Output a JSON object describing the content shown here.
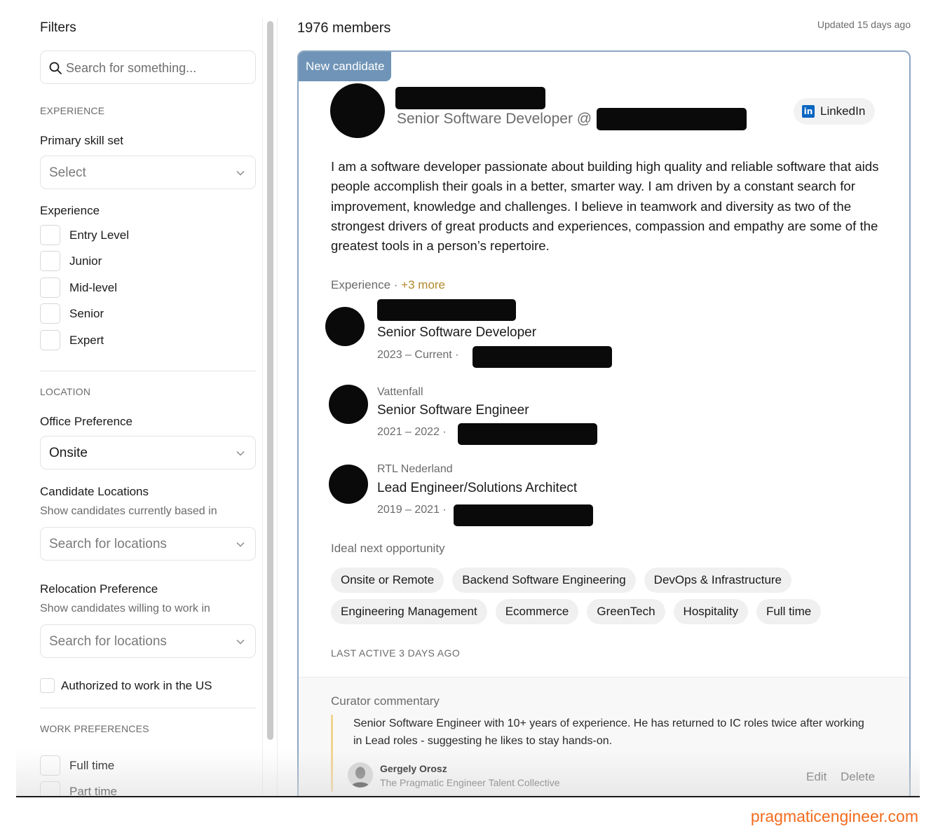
{
  "sidebar": {
    "title": "Filters",
    "search_placeholder": "Search for something...",
    "experience_section": "EXPERIENCE",
    "primary_skill_label": "Primary skill set",
    "primary_skill_value": "Select",
    "experience_label": "Experience",
    "experience_levels": [
      "Entry Level",
      "Junior",
      "Mid-level",
      "Senior",
      "Expert"
    ],
    "location_section": "LOCATION",
    "office_pref_label": "Office Preference",
    "office_pref_value": "Onsite",
    "candidate_locations_label": "Candidate Locations",
    "candidate_locations_help": "Show candidates currently based in",
    "candidate_locations_placeholder": "Search for locations",
    "relocation_label": "Relocation Preference",
    "relocation_help": "Show candidates willing to work in",
    "relocation_placeholder": "Search for locations",
    "authorized_label": "Authorized to work in the US",
    "work_pref_section": "WORK PREFERENCES",
    "work_prefs": [
      "Full time",
      "Part time"
    ]
  },
  "header": {
    "members_count": "1976 members",
    "updated": "Updated 15 days ago"
  },
  "card": {
    "badge": "New candidate",
    "headline": "Senior Software Developer @",
    "linkedin_label": "LinkedIn",
    "bio": "I am a software developer passionate about building high quality and reliable software that aids people accomplish their goals in a better, smarter way. I am driven by a constant search for improvement, knowledge and challenges. I believe in teamwork and diversity as two of the strongest drivers of great products and experiences, compassion and empathy are some of the greatest tools in a person’s repertoire.",
    "experience_label": "Experience ·",
    "experience_more": "+3 more",
    "jobs": [
      {
        "company": "",
        "title": "Senior Software Developer",
        "dates": "2023 – Current ·"
      },
      {
        "company": "Vattenfall",
        "title": "Senior Software Engineer",
        "dates": "2021 – 2022 ·"
      },
      {
        "company": "RTL Nederland",
        "title": "Lead Engineer/Solutions Architect",
        "dates": "2019 – 2021 ·"
      }
    ],
    "ideal_label": "Ideal next opportunity",
    "chips": [
      "Onsite or Remote",
      "Backend Software Engineering",
      "DevOps & Infrastructure",
      "Engineering Management",
      "Ecommerce",
      "GreenTech",
      "Hospitality",
      "Full time"
    ],
    "last_active": "LAST ACTIVE 3 DAYS AGO",
    "curator": {
      "label": "Curator commentary",
      "text": "Senior Software Engineer with 10+ years of experience. He has returned to IC roles twice after working in Lead roles - suggesting he likes to stay hands-on.",
      "author_name": "Gergely Orosz",
      "author_org": "The Pragmatic Engineer Talent Collective",
      "edit_label": "Edit",
      "delete_label": "Delete"
    }
  },
  "watermark": "pragmaticengineer.com",
  "colors": {
    "badge": "#6f94b7",
    "card_border": "#8ba7c2",
    "more_link": "#b0882a",
    "linkedin": "#0a66c2",
    "curator_bar": "#f1d391",
    "watermark": "#f26b1d"
  }
}
